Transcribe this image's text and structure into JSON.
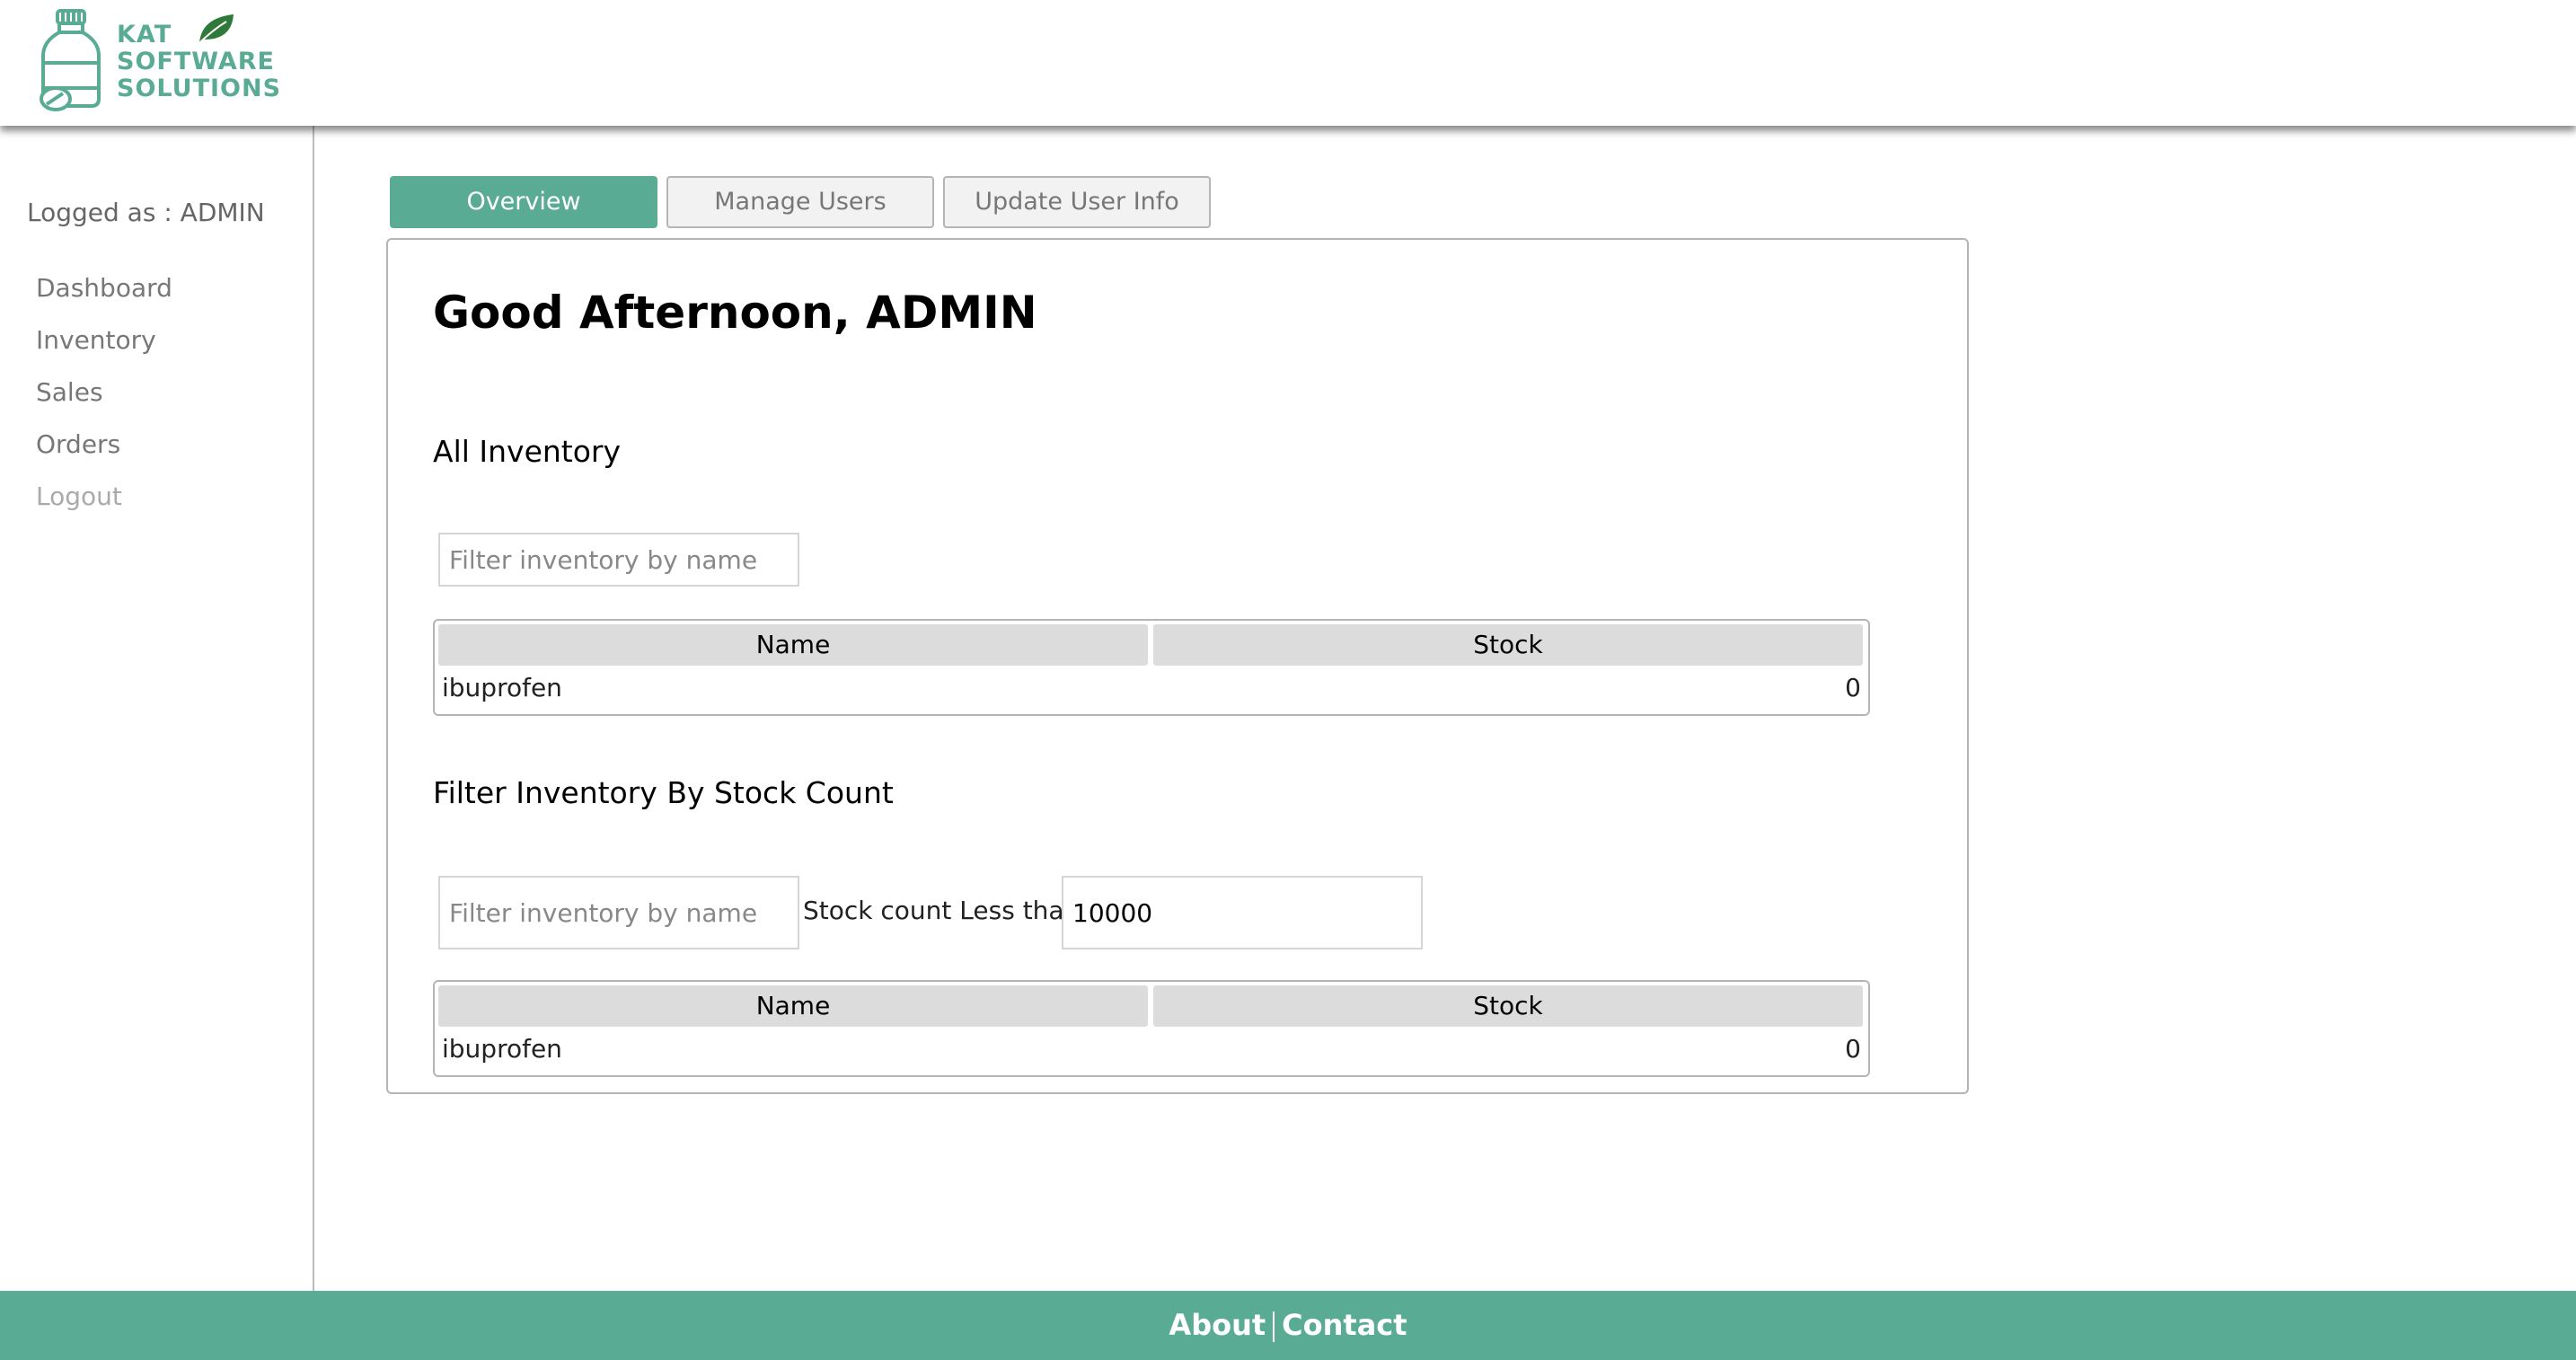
{
  "brand": {
    "line1": "KAT",
    "line2": "SOFTWARE",
    "line3": "SOLUTIONS",
    "color": "#5aab94"
  },
  "sidebar": {
    "logged_as": "Logged as : ADMIN",
    "items": [
      {
        "label": "Dashboard"
      },
      {
        "label": "Inventory"
      },
      {
        "label": "Sales"
      },
      {
        "label": "Orders"
      },
      {
        "label": "Logout"
      }
    ]
  },
  "tabs": [
    {
      "label": "Overview",
      "active": true
    },
    {
      "label": "Manage Users",
      "active": false
    },
    {
      "label": "Update User Info",
      "active": false
    }
  ],
  "main": {
    "greeting": "Good Afternoon, ADMIN",
    "all_inventory": {
      "title": "All Inventory",
      "filter_placeholder": "Filter inventory by name",
      "columns": [
        "Name",
        "Stock"
      ],
      "rows": [
        {
          "name": "ibuprofen",
          "stock": "0"
        }
      ]
    },
    "stock_filter": {
      "title": "Filter Inventory By Stock Count",
      "filter_placeholder": "Filter inventory by name",
      "stock_label": "Stock count Less than:",
      "stock_value": "10000",
      "columns": [
        "Name",
        "Stock"
      ],
      "rows": [
        {
          "name": "ibuprofen",
          "stock": "0"
        }
      ]
    }
  },
  "footer": {
    "about": "About",
    "contact": "Contact"
  },
  "colors": {
    "accent": "#5aab94",
    "leaf": "#2f7a3a"
  }
}
